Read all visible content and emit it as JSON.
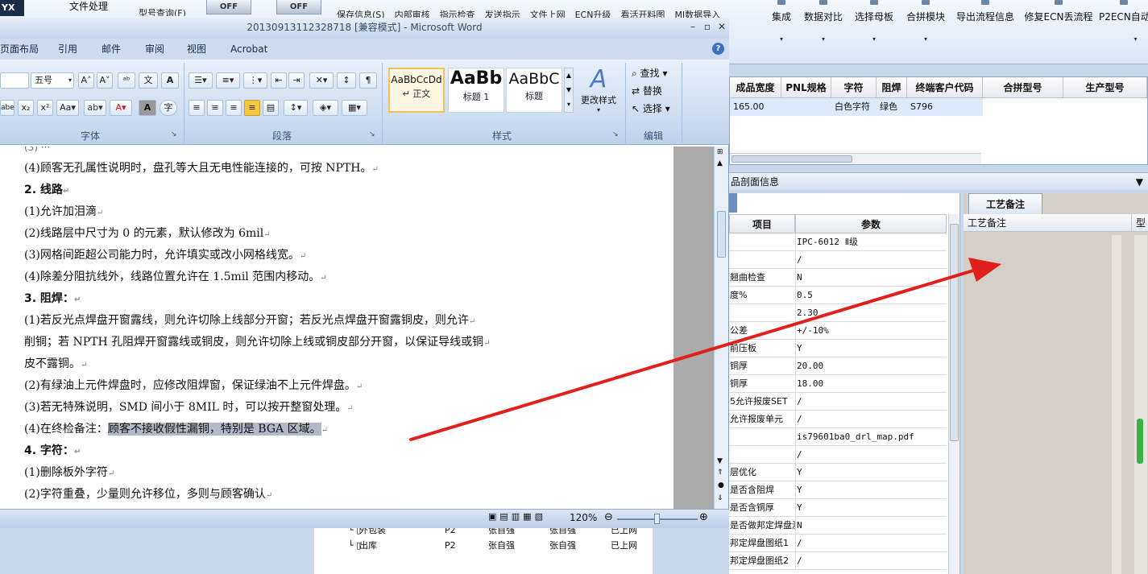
{
  "bg_app": {
    "top_left_text": "YX",
    "file_menu": "文件处理",
    "cut_text_1": "型号查询(F)",
    "toggle_off_1": "OFF",
    "toggle_off_2": "OFF",
    "cut_buttons": [
      "保存信息(S)",
      "内部审核",
      "指示检查",
      "发送指示",
      "文件上网",
      "ECN升级",
      "看活开料图",
      "MI数据导入"
    ],
    "toolbar": [
      "集成",
      "数据对比",
      "选择母板",
      "合拼模块",
      "导出流程信息",
      "修复ECN丢流程",
      "P2ECN自动"
    ],
    "grid_headers": [
      "成品宽度",
      "PNL规格",
      "字符",
      "阻焊",
      "终端客户代码",
      "合拼型号",
      "生产型号"
    ],
    "grid_row": [
      "165.00",
      "",
      "白色字符",
      "绿色",
      "S796"
    ],
    "section_header": "品剖面信息",
    "param_headers": [
      "项目",
      "参数"
    ],
    "params": [
      {
        "k": "",
        "v": "IPC-6012 Ⅱ级"
      },
      {
        "k": "",
        "v": "/"
      },
      {
        "k": "翘曲检查",
        "v": "N"
      },
      {
        "k": "度%",
        "v": "0.5"
      },
      {
        "k": "",
        "v": "2.30"
      },
      {
        "k": "公差",
        "v": "+/-10%"
      },
      {
        "k": "前压板",
        "v": "Y"
      },
      {
        "k": "铜厚",
        "v": "20.00"
      },
      {
        "k": "铜厚",
        "v": "18.00"
      },
      {
        "k": "5允许报废SET",
        "v": "/"
      },
      {
        "k": "允许报废单元",
        "v": "/"
      },
      {
        "k": "",
        "v": "is79601ba0_drl_map.pdf"
      },
      {
        "k": "",
        "v": "/"
      },
      {
        "k": "层优化",
        "v": "Y"
      },
      {
        "k": "是否含阻焊",
        "v": "Y"
      },
      {
        "k": "是否含铜厚",
        "v": "Y"
      },
      {
        "k": "是否做邦定焊盘测试",
        "v": "N"
      },
      {
        "k": "邦定焊盘图纸1",
        "v": "/"
      },
      {
        "k": "邦定焊盘图纸2",
        "v": "/"
      }
    ],
    "note_tab": "工艺备注",
    "note_header": "工艺备注",
    "note_side": "型",
    "tree_rows": [
      {
        "name": "外包装",
        "code": "P2",
        "a": "张自强",
        "b": "张自强",
        "c": "已上网"
      },
      {
        "name": "出库",
        "code": "P2",
        "a": "张自强",
        "b": "张自强",
        "c": "已上网"
      }
    ]
  },
  "word": {
    "title": "20130913112328718 [兼容模式] - Microsoft Word",
    "tabs": [
      "页面布局",
      "引用",
      "邮件",
      "审阅",
      "视图",
      "Acrobat"
    ],
    "font_size": "五号",
    "groups": [
      "字体",
      "段落",
      "样式",
      "编辑"
    ],
    "styles": [
      {
        "preview": "AaBbCcDd",
        "name": "↵ 正文"
      },
      {
        "preview": "AaBb",
        "name": "标题 1"
      },
      {
        "preview": "AaBbC",
        "name": "标题"
      }
    ],
    "change_styles": "更改样式",
    "edit_buttons": [
      "查找",
      "替换",
      "选择"
    ],
    "zoom": "120%",
    "doc_lines": [
      {
        "t": "(4)顾客无孔属性说明时，盘孔等大且无电性能连接的，可按 NPTH。",
        "b": false
      },
      {
        "t": "2. 线路",
        "b": true
      },
      {
        "t": "(1)允许加泪滴",
        "b": false
      },
      {
        "t": "(2)线路层中尺寸为 0 的元素，默认修改为 6mil",
        "b": false
      },
      {
        "t": "(3)网格间距超公司能力时，允许填实或改小网格线宽。",
        "b": false
      },
      {
        "t": "(4)除差分阻抗线外，线路位置允许在 1.5mil 范围内移动。",
        "b": false
      },
      {
        "t": "3. 阻焊：",
        "b": true
      },
      {
        "t": "(1)若反光点焊盘开窗露线，则允许切除上线部分开窗；若反光点焊盘开窗露铜皮，则允许",
        "b": false
      },
      {
        "t": "削铜；若 NPTH 孔阻焊开窗露线或铜皮，则允许切除上线或铜皮部分开窗，以保证导线或铜",
        "b": false
      },
      {
        "t": "皮不露铜。",
        "b": false
      },
      {
        "t": "(2)有绿油上元件焊盘时，应修改阻焊窗，保证绿油不上元件焊盘。",
        "b": false
      },
      {
        "t": "(3)若无特殊说明，SMD 间小于 8MIL 时，可以按开整窗处理。",
        "b": false
      },
      {
        "t": "(4)在终检备注：",
        "b": false
      },
      {
        "t": "4. 字符：",
        "b": true
      },
      {
        "t": "(1)删除板外字符",
        "b": false
      },
      {
        "t": "(2)字符重叠，少量则允许移位，多则与顾客确认",
        "b": false
      }
    ],
    "highlight_text": "顾客不接收假性漏铜，特别是 BGA 区域。",
    "para_mark": "↵"
  },
  "colors": {
    "arrow": "#e0201a",
    "highlight": "#b1bac6"
  }
}
